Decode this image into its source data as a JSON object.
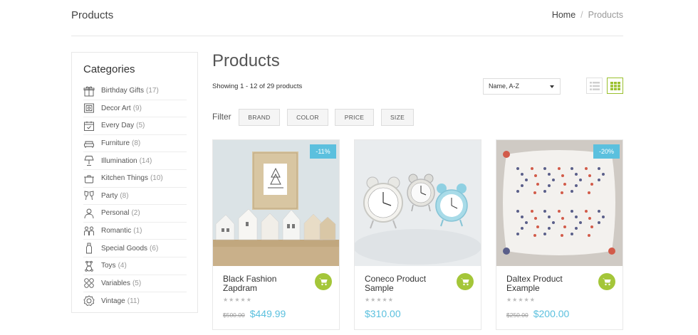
{
  "header": {
    "title": "Products",
    "breadcrumb": {
      "home": "Home",
      "separator": "/",
      "current": "Products"
    }
  },
  "sidebar": {
    "title": "Categories",
    "items": [
      {
        "label": "Birthday Gifts",
        "count": "(17)",
        "icon": "gift-icon"
      },
      {
        "label": "Decor Art",
        "count": "(9)",
        "icon": "frame-icon"
      },
      {
        "label": "Every Day",
        "count": "(5)",
        "icon": "calendar-icon"
      },
      {
        "label": "Furniture",
        "count": "(8)",
        "icon": "sofa-icon"
      },
      {
        "label": "Illumination",
        "count": "(14)",
        "icon": "lamp-icon"
      },
      {
        "label": "Kitchen Things",
        "count": "(10)",
        "icon": "pot-icon"
      },
      {
        "label": "Party",
        "count": "(8)",
        "icon": "glasses-icon"
      },
      {
        "label": "Personal",
        "count": "(2)",
        "icon": "person-icon"
      },
      {
        "label": "Romantic",
        "count": "(1)",
        "icon": "couple-icon"
      },
      {
        "label": "Special Goods",
        "count": "(6)",
        "icon": "bottle-icon"
      },
      {
        "label": "Toys",
        "count": "(4)",
        "icon": "teddy-icon"
      },
      {
        "label": "Variables",
        "count": "(5)",
        "icon": "grid-dots-icon"
      },
      {
        "label": "Vintage",
        "count": "(11)",
        "icon": "badge-icon"
      }
    ]
  },
  "main": {
    "title": "Products",
    "showing": "Showing 1 - 12 of 29 products",
    "sort": {
      "selected": "Name, A-Z"
    },
    "filter": {
      "label": "Filter",
      "buttons": [
        "BRAND",
        "COLOR",
        "PRICE",
        "SIZE"
      ]
    },
    "products": [
      {
        "name": "Black Fashion Zapdram",
        "old_price": "$500.00",
        "price": "$449.99",
        "badge": "-11%",
        "stars": "★★★★★"
      },
      {
        "name": "Coneco Product Sample",
        "old_price": "",
        "price": "$310.00",
        "badge": "",
        "stars": "★★★★★"
      },
      {
        "name": "Daltex Product Example",
        "old_price": "$250.00",
        "price": "$200.00",
        "badge": "-20%",
        "stars": "★★★★★"
      }
    ]
  },
  "colors": {
    "accent_green": "#a4c639",
    "price_blue": "#5bc0de",
    "badge_blue": "#5bc0de"
  }
}
